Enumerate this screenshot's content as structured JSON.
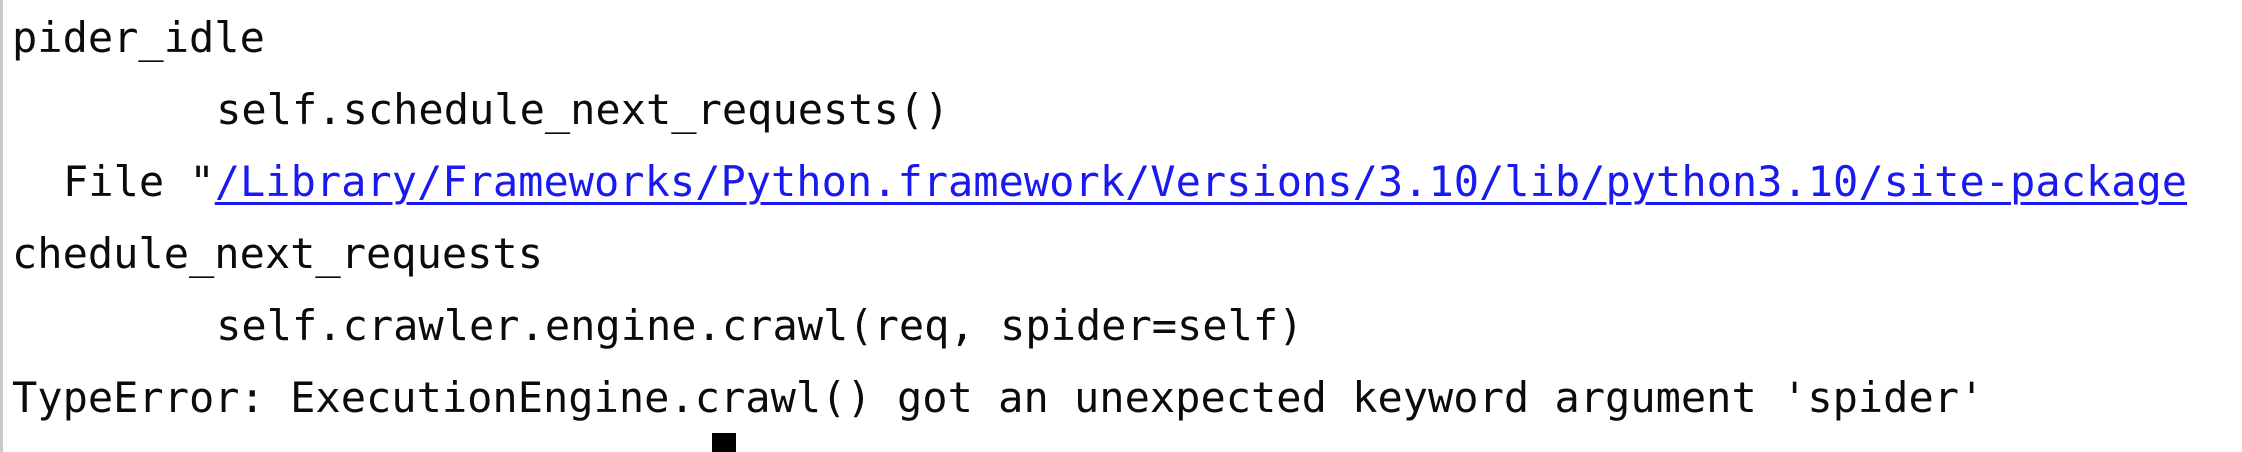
{
  "terminal": {
    "lines": [
      "pider_idle",
      "    self.schedule_next_requests()",
      "chedule_next_requests",
      "    self.crawler.engine.crawl(req, spider=self)",
      "TypeError: ExecutionEngine.crawl() got an unexpected keyword argument 'spider'"
    ],
    "file_prefix": "File \"",
    "file_path": "/Library/Frameworks/Python.framework/Versions/3.10/lib/python3.10/site-package"
  },
  "colors": {
    "background": "#ffffff",
    "text": "#0b0b0b",
    "link": "#1a1aee",
    "cursor": "#000000"
  }
}
